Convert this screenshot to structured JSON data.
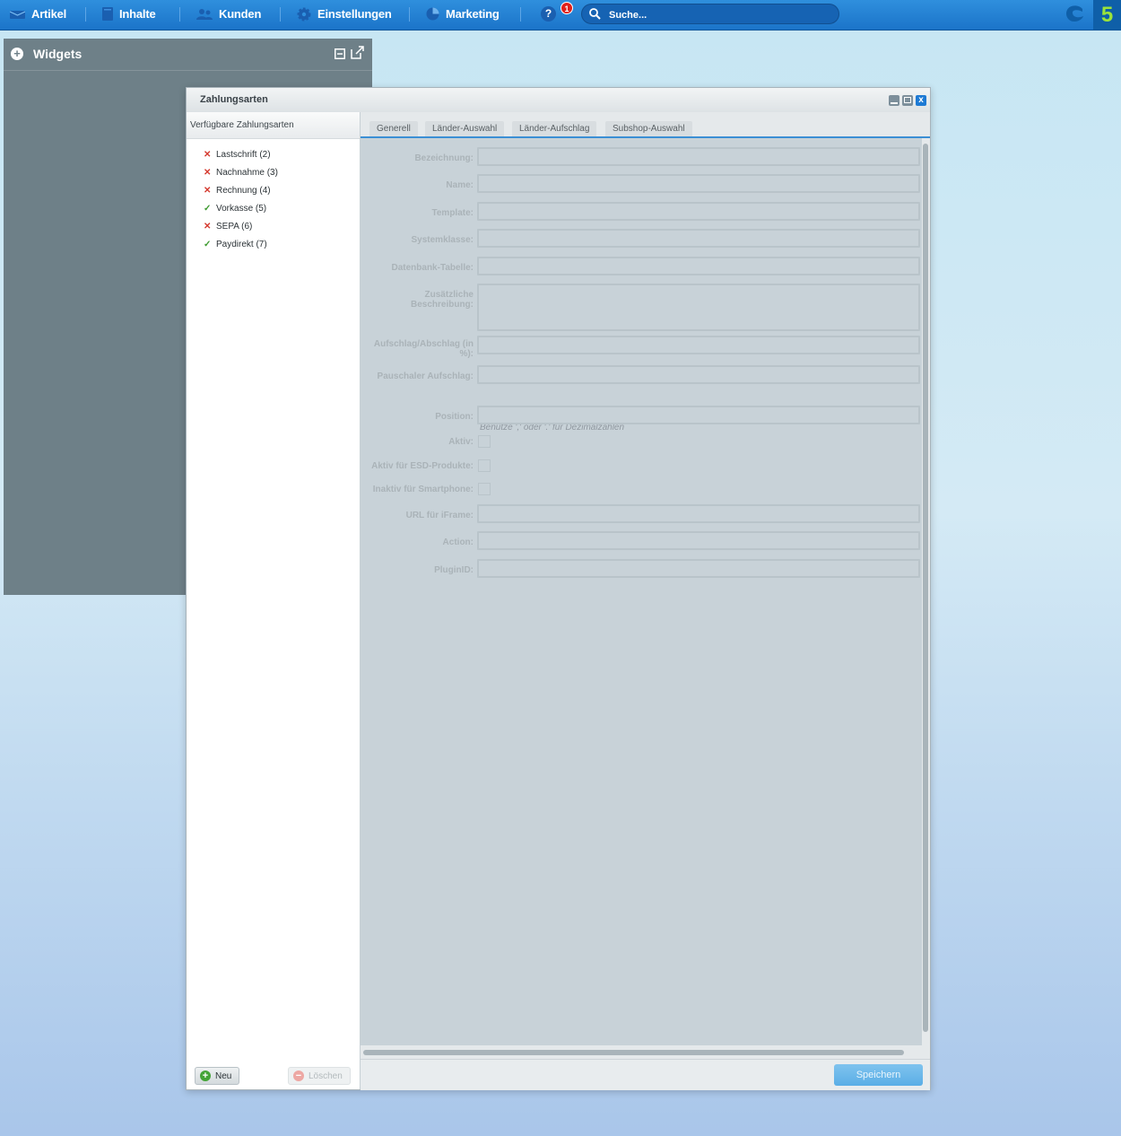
{
  "topbar": {
    "nav": [
      {
        "label": "Artikel",
        "icon": "package-icon"
      },
      {
        "label": "Inhalte",
        "icon": "document-icon"
      },
      {
        "label": "Kunden",
        "icon": "users-icon"
      },
      {
        "label": "Einstellungen",
        "icon": "gear-icon"
      },
      {
        "label": "Marketing",
        "icon": "pie-chart-icon"
      }
    ],
    "help_symbol": "?",
    "notification_count": "1",
    "search_placeholder": "Suche...",
    "version_badge": "5",
    "brand_color": "#1b74c9"
  },
  "widgets": {
    "plus_symbol": "+",
    "title": "Widgets"
  },
  "window": {
    "title": "Zahlungsarten",
    "close_symbol": "x",
    "tree": {
      "header": "Verfügbare Zahlungsarten",
      "items": [
        {
          "label": "Lastschrift (2)",
          "active": false,
          "mark": "✕"
        },
        {
          "label": "Nachnahme (3)",
          "active": false,
          "mark": "✕"
        },
        {
          "label": "Rechnung (4)",
          "active": false,
          "mark": "✕"
        },
        {
          "label": "Vorkasse (5)",
          "active": true,
          "mark": "✓"
        },
        {
          "label": "SEPA (6)",
          "active": false,
          "mark": "✕"
        },
        {
          "label": "Paydirekt (7)",
          "active": true,
          "mark": "✓"
        }
      ],
      "new_label": "Neu",
      "new_icon_symbol": "+",
      "delete_label": "Löschen",
      "delete_icon_symbol": "−"
    },
    "tabs": [
      "Generell",
      "Länder-Auswahl",
      "Länder-Aufschlag",
      "Subshop-Auswahl"
    ],
    "form": {
      "fields": {
        "bezeichnung": "Bezeichnung:",
        "name": "Name:",
        "template": "Template:",
        "systemklasse": "Systemklasse:",
        "datenbank": "Datenbank-Tabelle:",
        "beschreibung": "Zusätzliche Beschreibung:",
        "aufschlag": "Aufschlag/Abschlag (in %):",
        "pauschal": "Pauschaler Aufschlag:",
        "position": "Position:",
        "aktiv": "Aktiv:",
        "aktiv_esd": "Aktiv für ESD-Produkte:",
        "inaktiv_smartphone": "Inaktiv für Smartphone:",
        "url_iframe": "URL für iFrame:",
        "action": "Action:",
        "pluginid": "PluginID:"
      },
      "hint": "Benutze ',' oder '.' für Dezimalzahlen",
      "save_label": "Speichern"
    }
  }
}
